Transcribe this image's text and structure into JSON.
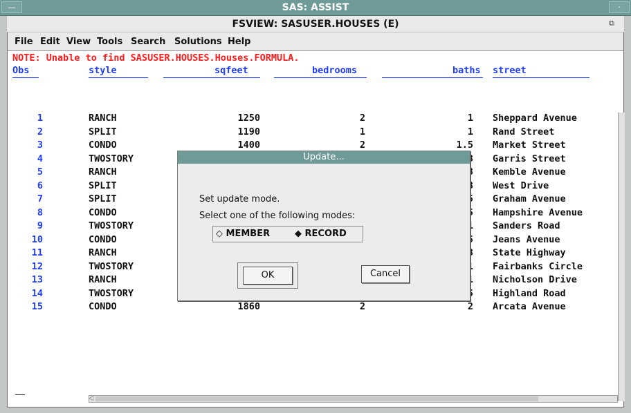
{
  "outer_window": {
    "title": "SAS: ASSIST",
    "sys_menu": "—",
    "minimize": "·"
  },
  "window": {
    "title": "FSVIEW:  SASUSER.HOUSES (E)",
    "restore_icon": "⧉"
  },
  "menu": {
    "file": "File",
    "edit": "Edit",
    "view": "View",
    "tools": "Tools",
    "search": "Search",
    "solutions": "Solutions",
    "help": "Help"
  },
  "note": "NOTE: Unable to find SASUSER.HOUSES.Houses.FORMULA.",
  "table": {
    "headers": {
      "obs": "Obs",
      "style": "style",
      "sqfeet": "sqfeet",
      "bedrooms": "bedrooms",
      "baths": "baths",
      "street": "street"
    },
    "rows": [
      {
        "obs": "1",
        "style": "RANCH",
        "sqfeet": "1250",
        "bedrooms": "2",
        "baths": "1",
        "street": "Sheppard Avenue"
      },
      {
        "obs": "2",
        "style": "SPLIT",
        "sqfeet": "1190",
        "bedrooms": "1",
        "baths": "1",
        "street": "Rand Street"
      },
      {
        "obs": "3",
        "style": "CONDO",
        "sqfeet": "1400",
        "bedrooms": "2",
        "baths": "1.5",
        "street": "Market Street"
      },
      {
        "obs": "4",
        "style": "TWOSTORY",
        "sqfeet": "",
        "bedrooms": "",
        "baths": "3",
        "street": "Garris Street"
      },
      {
        "obs": "5",
        "style": "RANCH",
        "sqfeet": "",
        "bedrooms": "",
        "baths": "3",
        "street": "Kemble Avenue"
      },
      {
        "obs": "6",
        "style": "SPLIT",
        "sqfeet": "",
        "bedrooms": "",
        "baths": "3",
        "street": "West Drive"
      },
      {
        "obs": "7",
        "style": "SPLIT",
        "sqfeet": "",
        "bedrooms": "",
        "baths": "5",
        "street": "Graham Avenue"
      },
      {
        "obs": "8",
        "style": "CONDO",
        "sqfeet": "",
        "bedrooms": "",
        "baths": "5",
        "street": "Hampshire Avenue"
      },
      {
        "obs": "9",
        "style": "TWOSTORY",
        "sqfeet": "",
        "bedrooms": "",
        "baths": "1",
        "street": "Sanders Road"
      },
      {
        "obs": "10",
        "style": "CONDO",
        "sqfeet": "",
        "bedrooms": "",
        "baths": "5",
        "street": "Jeans Avenue"
      },
      {
        "obs": "11",
        "style": "RANCH",
        "sqfeet": "",
        "bedrooms": "",
        "baths": "3",
        "street": "State Highway"
      },
      {
        "obs": "12",
        "style": "TWOSTORY",
        "sqfeet": "",
        "bedrooms": "",
        "baths": "1",
        "street": "Fairbanks Circle"
      },
      {
        "obs": "13",
        "style": "RANCH",
        "sqfeet": "",
        "bedrooms": "",
        "baths": "1",
        "street": "Nicholson Drive"
      },
      {
        "obs": "14",
        "style": "TWOSTORY",
        "sqfeet": "",
        "bedrooms": "",
        "baths": "5",
        "street": "Highland Road"
      },
      {
        "obs": "15",
        "style": "CONDO",
        "sqfeet": "1860",
        "bedrooms": "2",
        "baths": "2",
        "street": "Arcata Avenue"
      }
    ]
  },
  "dialog": {
    "title": "Update...",
    "line1": "Set update mode.",
    "line2": "Select one of the following modes:",
    "member_label": "MEMBER",
    "record_label": "RECORD",
    "member_symbol": "◇",
    "record_symbol": "◆",
    "selected_mode": "RECORD",
    "ok_label": "OK",
    "cancel_label": "Cancel"
  },
  "colors": {
    "title_bar": "#6e9a98",
    "note_text": "#ff1a1a",
    "header_text": "#1e3cff"
  }
}
